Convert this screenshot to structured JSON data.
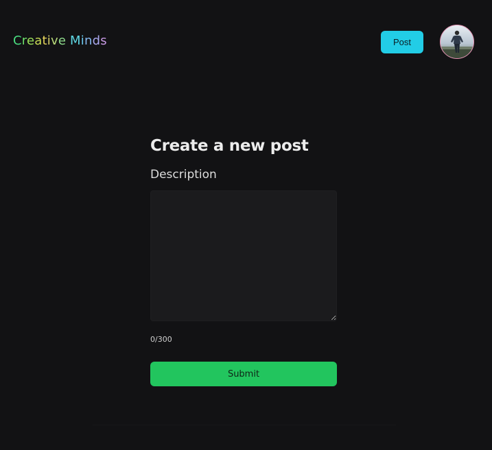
{
  "header": {
    "logo_letters": [
      {
        "char": "C",
        "color": "#4ade80"
      },
      {
        "char": "r",
        "color": "#6ee06a"
      },
      {
        "char": "e",
        "color": "#9be15a"
      },
      {
        "char": "a",
        "color": "#c9dd55"
      },
      {
        "char": "t",
        "color": "#e6d45a"
      },
      {
        "char": "i",
        "color": "#d9d26a"
      },
      {
        "char": "v",
        "color": "#b8d97a"
      },
      {
        "char": "e",
        "color": "#8fdc8c"
      },
      {
        "char": " ",
        "color": "#8fdc8c"
      },
      {
        "char": "M",
        "color": "#5fd9e6"
      },
      {
        "char": "i",
        "color": "#6bc9ef"
      },
      {
        "char": "n",
        "color": "#86b8ef"
      },
      {
        "char": "d",
        "color": "#a9a7ee"
      },
      {
        "char": "s",
        "color": "#c99be6"
      }
    ],
    "post_button_label": "Post",
    "avatar_icon": "user-avatar-photo",
    "colors": {
      "post_button": "#22cde6",
      "avatar_border": "#e58fb0"
    }
  },
  "form": {
    "title": "Create a new post",
    "description_label": "Description",
    "description_value": "",
    "counter": "0/300",
    "submit_label": "Submit",
    "colors": {
      "submit_button": "#22c55e",
      "background": "#121214"
    }
  }
}
